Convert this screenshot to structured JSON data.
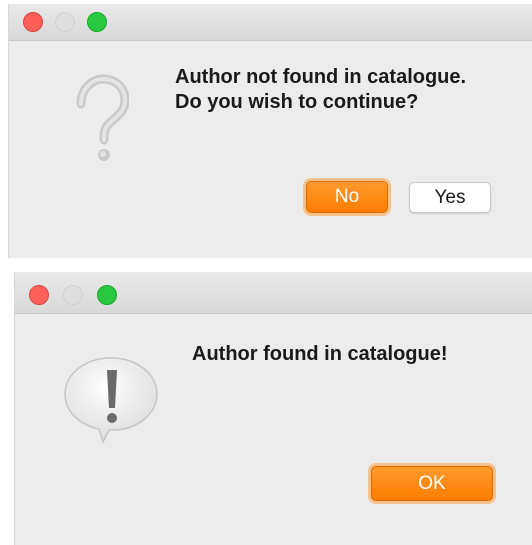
{
  "dialogs": [
    {
      "message_line1": "Author not found in catalogue.",
      "message_line2": "Do you wish to continue?",
      "icon": "question-mark-icon",
      "buttons": {
        "no_label": "No",
        "yes_label": "Yes"
      },
      "default_button": "No"
    },
    {
      "message_line1": "Author found in catalogue!",
      "icon": "exclamation-speech-bubble-icon",
      "buttons": {
        "ok_label": "OK"
      },
      "default_button": "OK"
    }
  ],
  "colors": {
    "close": "#fe5f57",
    "minimize_disabled": "#dedede",
    "zoom": "#28c840",
    "default_button": "#ff8a1a",
    "dialog_background": "#ececec"
  }
}
